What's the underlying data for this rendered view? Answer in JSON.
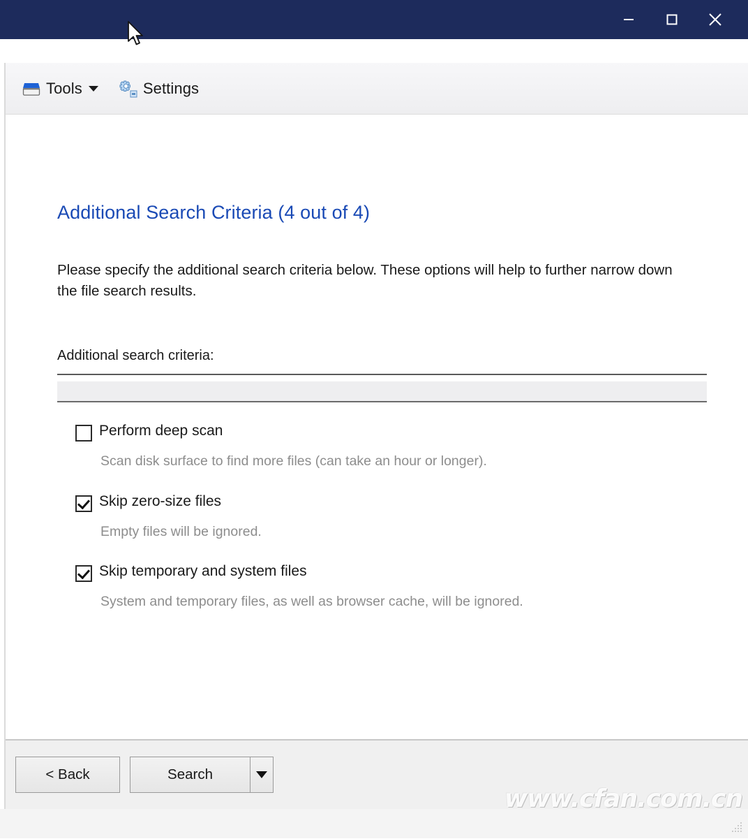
{
  "window": {
    "titlebar_color": "#1d2b5c",
    "controls": [
      {
        "name": "minimize",
        "glyph": "minimize-icon"
      },
      {
        "name": "maximize",
        "glyph": "maximize-icon"
      },
      {
        "name": "close",
        "glyph": "close-icon"
      }
    ]
  },
  "toolbar": {
    "items": [
      {
        "label": "Tools",
        "icon": "drive-icon",
        "has_caret": true
      },
      {
        "label": "Settings",
        "icon": "gear-icon",
        "has_caret": false
      }
    ]
  },
  "page": {
    "title": "Additional Search Criteria (4 out of 4)",
    "title_color": "#1a4ab5",
    "description": "Please specify the additional search criteria below. These options will help to further narrow down the file search results.",
    "section_label": "Additional search criteria:",
    "options": [
      {
        "label": "Perform deep scan",
        "checked": false,
        "description": "Scan disk surface to find more files (can take an hour or longer)."
      },
      {
        "label": "Skip zero-size files",
        "checked": true,
        "description": "Empty files will be ignored."
      },
      {
        "label": "Skip temporary and system files",
        "checked": true,
        "description": "System and temporary files, as well as browser cache, will be ignored."
      }
    ]
  },
  "footer": {
    "back_label": "< Back",
    "search_label": "Search",
    "dropdown_icon": "triangle-down-icon"
  },
  "watermark": {
    "text": "www.cfan.com.cn"
  }
}
